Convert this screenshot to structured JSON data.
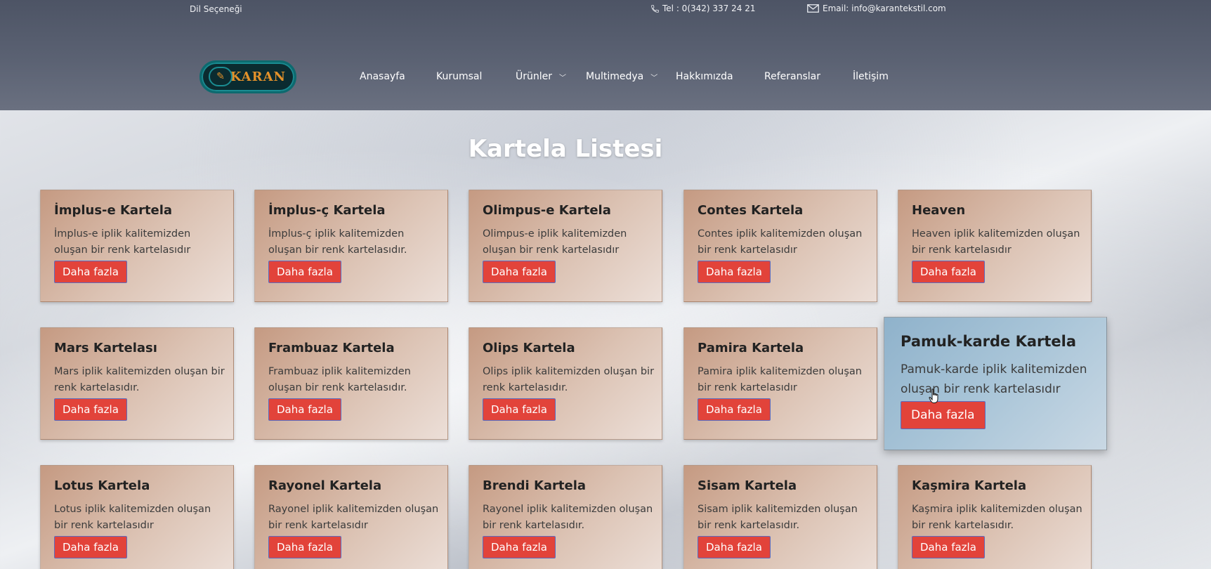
{
  "header": {
    "language": "Dil Seçeneği",
    "phone": "Tel : 0(342) 337 24 21",
    "email": "Email: info@karantekstil.com",
    "logo_text": "KARAN",
    "nav": [
      {
        "label": "Anasayfa"
      },
      {
        "label": "Kurumsal"
      },
      {
        "label": "Ürünler"
      },
      {
        "label": "Multimedya"
      },
      {
        "label": "Hakkımızda"
      },
      {
        "label": "Referanslar"
      },
      {
        "label": "İletişim"
      }
    ]
  },
  "page": {
    "title": "Kartela Listesi",
    "button_label": "Daha fazla"
  },
  "cards": [
    {
      "title": "İmplus-e Kartela",
      "desc": "İmplus-e iplik kalitemizden oluşan bir renk kartelasıdır"
    },
    {
      "title": "İmplus-ç Kartela",
      "desc": "İmplus-ç iplik kalitemizden oluşan bir renk kartelasıdır."
    },
    {
      "title": "Olimpus-e Kartela",
      "desc": "Olimpus-e iplik kalitemizden oluşan bir renk kartelasıdır"
    },
    {
      "title": "Contes Kartela",
      "desc": "Contes iplik kalitemizden oluşan bir renk kartelasıdır"
    },
    {
      "title": "Heaven",
      "desc": "Heaven iplik kalitemizden oluşan bir renk kartelasıdır"
    },
    {
      "title": "Mars Kartelası",
      "desc": "Mars iplik kalitemizden oluşan bir renk kartelasıdır."
    },
    {
      "title": "Frambuaz Kartela",
      "desc": "Frambuaz iplik kalitemizden oluşan bir renk kartelasıdır."
    },
    {
      "title": "Olips Kartela",
      "desc": "Olips iplik kalitemizden oluşan bir renk kartelasıdır."
    },
    {
      "title": "Pamira Kartela",
      "desc": "Pamira iplik kalitemizden oluşan bir renk kartelasıdır"
    },
    {
      "title": "Pamuk-karde Kartela",
      "desc": "Pamuk-karde iplik kalitemizden oluşan bir renk kartelasıdır"
    },
    {
      "title": "Lotus Kartela",
      "desc": "Lotus iplik kalitemizden oluşan bir renk kartelasıdır"
    },
    {
      "title": "Rayonel Kartela",
      "desc": "Rayonel iplik kalitemizden oluşan bir renk kartelasıdır"
    },
    {
      "title": "Brendi Kartela",
      "desc": "Rayonel iplik kalitemizden oluşan bir renk kartelasıdır."
    },
    {
      "title": "Sisam Kartela",
      "desc": "Sisam iplik kalitemizden oluşan bir renk kartelasıdır."
    },
    {
      "title": "Kaşmira Kartela",
      "desc": "Kaşmira iplik kalitemizden oluşan bir renk kartelasıdır."
    }
  ],
  "icons": {
    "phone": "phone-icon",
    "email": "envelope-icon",
    "dropdown": "chevron-down-icon",
    "cursor": "hand-pointer-icon"
  }
}
